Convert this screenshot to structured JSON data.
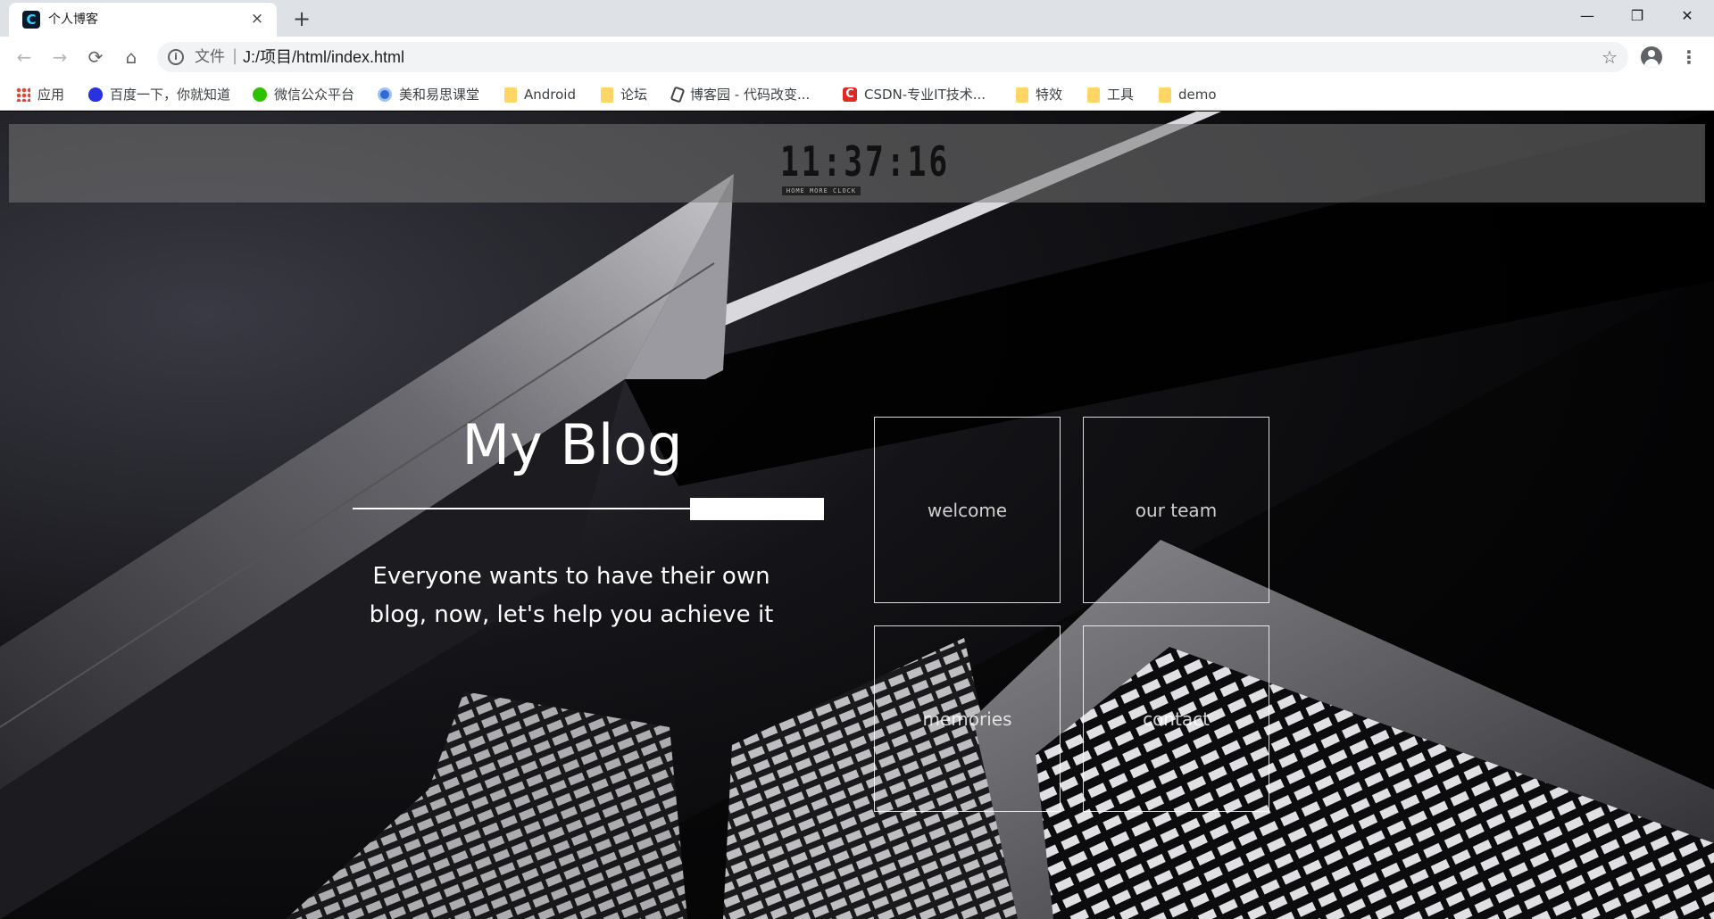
{
  "browser": {
    "tab": {
      "title": "个人博客",
      "favicon": "C",
      "close": "×"
    },
    "new_tab": "+",
    "window_controls": {
      "minimize": "—",
      "restore": "❐",
      "close": "✕"
    },
    "nav": {
      "back": "←",
      "forward": "→",
      "reload": "⟳",
      "home": "⌂"
    },
    "address": {
      "info": "i",
      "scheme": "文件",
      "separator": "|",
      "url": "J:/项目/html/index.html",
      "star": "☆"
    },
    "menu": "⋮",
    "bookmarks": [
      {
        "label": "应用",
        "icon": "apps-icon"
      },
      {
        "label": "百度一下，你就知道",
        "icon": "baidu-icon"
      },
      {
        "label": "微信公众平台",
        "icon": "wechat-icon"
      },
      {
        "label": "美和易思课堂",
        "icon": "globe-icon"
      },
      {
        "label": "Android",
        "icon": "folder-icon"
      },
      {
        "label": "论坛",
        "icon": "folder-icon"
      },
      {
        "label": "博客园 - 代码改变...",
        "icon": "cnblogs-icon"
      },
      {
        "label": "CSDN-专业IT技术...",
        "icon": "csdn-icon",
        "glyph": "C"
      },
      {
        "label": "特效",
        "icon": "folder-icon"
      },
      {
        "label": "工具",
        "icon": "folder-icon"
      },
      {
        "label": "demo",
        "icon": "folder-icon"
      }
    ]
  },
  "page": {
    "clock": {
      "time": "11:37:16",
      "caption": "HOME MORE CLOCK"
    },
    "title": "My Blog",
    "tagline": "Everyone wants to have their own blog, now, let's help you achieve it",
    "nav_boxes": [
      {
        "label": "welcome"
      },
      {
        "label": "our team"
      },
      {
        "label": "memories"
      },
      {
        "label": "contact"
      }
    ]
  },
  "colors": {
    "chrome_bg": "#dee1e6",
    "toolbar_bg": "#ffffff",
    "page_bg": "#000000",
    "accent": "#ffffff"
  }
}
